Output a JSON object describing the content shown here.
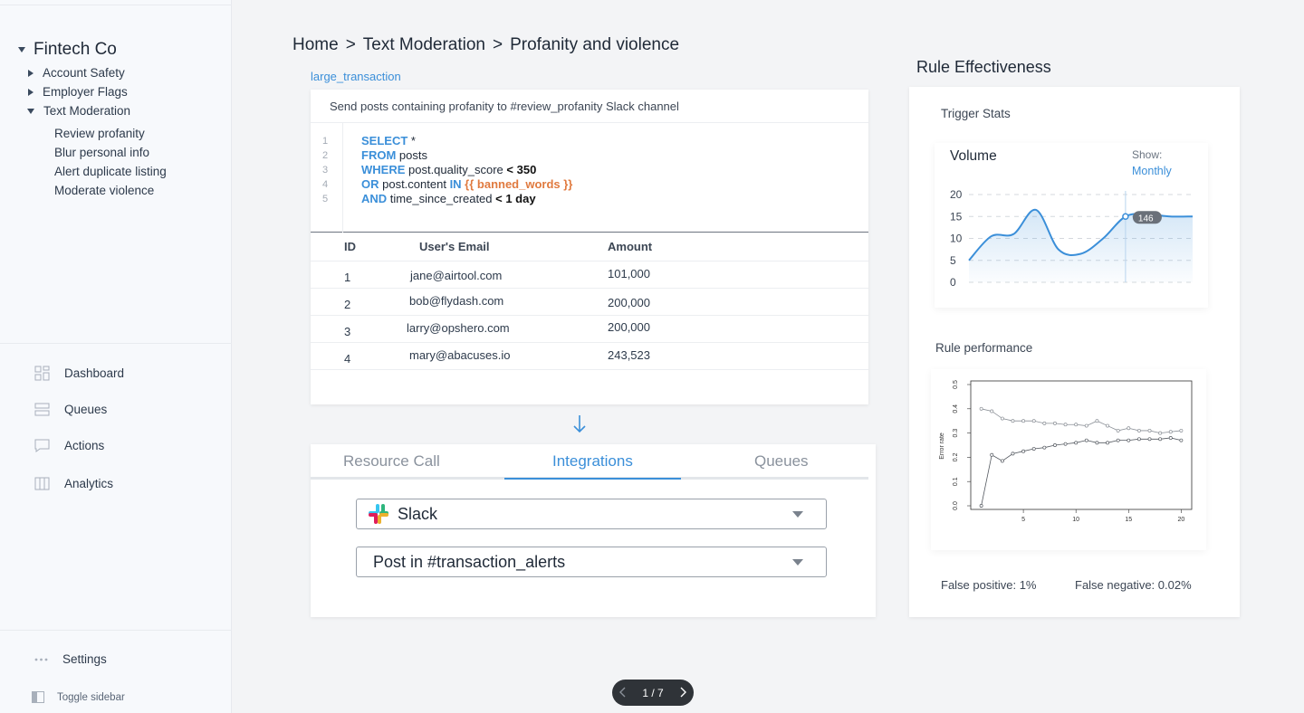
{
  "sidebar": {
    "org": "Fintech Co",
    "tree": [
      {
        "label": "Account Safety",
        "expanded": false
      },
      {
        "label": "Employer Flags",
        "expanded": false
      },
      {
        "label": "Text Moderation",
        "expanded": true
      }
    ],
    "leaves": [
      "Review profanity",
      "Blur personal info",
      "Alert duplicate listing",
      "Moderate violence"
    ],
    "nav": [
      {
        "label": "Dashboard",
        "icon": "dashboard-icon"
      },
      {
        "label": "Queues",
        "icon": "queues-icon"
      },
      {
        "label": "Actions",
        "icon": "actions-icon"
      },
      {
        "label": "Analytics",
        "icon": "analytics-icon"
      }
    ],
    "settings": "Settings",
    "toggle": "Toggle sidebar"
  },
  "breadcrumb": [
    "Home",
    ">",
    "Text Moderation",
    ">",
    "Profanity and violence"
  ],
  "rule_tag": "large_transaction",
  "query": {
    "description": "Send posts containing profanity to #review_profanity Slack channel",
    "line_numbers": [
      "1",
      "2",
      "3",
      "4",
      "5"
    ],
    "lines": [
      {
        "kw": "SELECT",
        "rest": " *"
      },
      {
        "kw": "FROM",
        "rest": " posts"
      },
      {
        "kw": "WHERE",
        "rest": " post.quality_score ",
        "op": "< 350"
      },
      {
        "kw": "OR",
        "rest": " post.content ",
        "kw2": "IN",
        "tpl": " {{ banned_words }}"
      },
      {
        "kw": "AND",
        "rest": " time_since_created ",
        "op": "< 1 day"
      }
    ]
  },
  "table": {
    "headers": [
      "ID",
      "User's Email",
      "Amount"
    ],
    "rows": [
      [
        "1",
        "jane@airtool.com",
        "101,000"
      ],
      [
        "2",
        "bob@flydash.com",
        "200,000"
      ],
      [
        "3",
        "larry@opshero.com",
        "200,000"
      ],
      [
        "4",
        "mary@abacuses.io",
        "243,523"
      ]
    ]
  },
  "tabs": [
    "Resource Call",
    "Integrations",
    "Queues"
  ],
  "active_tab": 1,
  "integration": {
    "app": "Slack",
    "action": "Post in #transaction_alerts"
  },
  "effectiveness": {
    "title": "Rule Effectiveness",
    "trigger_label": "Trigger Stats",
    "volume_title": "Volume",
    "show_label": "Show:",
    "show_value": "Monthly",
    "tooltip": "146",
    "perf_label": "Rule performance",
    "false_positive": "False positive: 1%",
    "false_negative": "False negative: 0.02%"
  },
  "chart_data": [
    {
      "type": "area",
      "title": "Volume",
      "y_ticks": [
        "20",
        "15",
        "10",
        "5",
        "0"
      ],
      "x": [
        0,
        1,
        2,
        3,
        4,
        5,
        6,
        7,
        8,
        9,
        10
      ],
      "values": [
        5,
        10.5,
        11,
        16.5,
        7.5,
        6.5,
        10,
        15,
        15.5,
        15,
        15
      ],
      "ylim": [
        0,
        20
      ],
      "highlight": {
        "x": 7,
        "label": "146"
      }
    },
    {
      "type": "line",
      "ylabel": "Error rate",
      "x_ticks": [
        "5",
        "10",
        "15",
        "20"
      ],
      "y_ticks": [
        "0.0",
        "0.1",
        "0.2",
        "0.3",
        "0.4",
        "0.5"
      ],
      "ylim": [
        0,
        0.5
      ],
      "xlim": [
        0,
        21
      ],
      "x": [
        1,
        2,
        3,
        4,
        5,
        6,
        7,
        8,
        9,
        10,
        11,
        12,
        13,
        14,
        15,
        16,
        17,
        18,
        19,
        20
      ],
      "series": [
        {
          "values": [
            0.4,
            0.39,
            0.36,
            0.35,
            0.35,
            0.35,
            0.34,
            0.34,
            0.335,
            0.335,
            0.33,
            0.35,
            0.33,
            0.31,
            0.32,
            0.31,
            0.31,
            0.3,
            0.305,
            0.31
          ]
        },
        {
          "values": [
            0.0,
            0.21,
            0.185,
            0.215,
            0.225,
            0.235,
            0.24,
            0.25,
            0.255,
            0.26,
            0.27,
            0.26,
            0.26,
            0.27,
            0.27,
            0.275,
            0.275,
            0.275,
            0.28,
            0.27
          ]
        }
      ]
    }
  ],
  "pager": "1 / 7",
  "colors": {
    "accent": "#3b8fd9",
    "template": "#e07a3f",
    "slack_red": "#e01e5a",
    "slack_blue": "#36c5f0",
    "slack_green": "#2eb67d",
    "slack_yellow": "#ecb22e"
  }
}
